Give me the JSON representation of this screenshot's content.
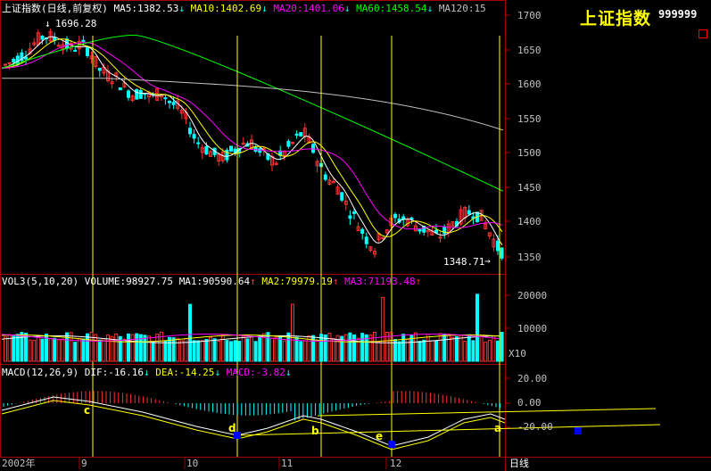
{
  "window": {
    "title": "上证指数",
    "code": "999999"
  },
  "price_panel": {
    "header": {
      "name": "上证指数(日线,前复权)",
      "ma5": "MA5:1382.53",
      "ma10": "MA10:1402.69",
      "ma20": "MA20:1401.06",
      "ma60": "MA60:1458.54",
      "ma120": "MA120:15",
      "arrow": "↓"
    },
    "y_ticks": [
      "1700",
      "1650",
      "1600",
      "1550",
      "1500",
      "1450",
      "1400",
      "1350"
    ],
    "high_label": "1696.28",
    "low_label": "1348.71"
  },
  "volume_panel": {
    "header": {
      "name": "VOL3(5,10,20)",
      "volume": "VOLUME:98927.75",
      "ma1": "MA1:90590.64",
      "ma2": "MA2:79979.19",
      "ma3": "MA3:71193.48",
      "arrow": "↑"
    },
    "y_ticks": [
      "20000",
      "10000"
    ],
    "unit": "X10"
  },
  "macd_panel": {
    "header": {
      "name": "MACD(12,26,9)",
      "dif": "DIF:-16.16",
      "dea": "DEA:-14.25",
      "macd": "MACD:-3.82",
      "arrow": "↓"
    },
    "y_ticks": [
      "20.00",
      "0.00",
      "-20.00"
    ],
    "point_labels": [
      "c",
      "d",
      "b",
      "e",
      "a"
    ]
  },
  "x_axis": {
    "labels": [
      "2002年",
      "9",
      "10",
      "11",
      "12"
    ],
    "period": "日线"
  },
  "colors": {
    "up": "#ff3232",
    "down": "#00ffff",
    "ma5": "#ffffff",
    "ma10": "#ffff00",
    "ma20": "#ff00ff",
    "ma60": "#00ff00",
    "ma120": "#c0c0c0",
    "grid": "#a00000"
  },
  "chart_data": {
    "type": "candlestick",
    "title": "上证指数(日线,前复权)",
    "y_range": [
      1340,
      1720
    ],
    "series": [
      {
        "name": "MA5",
        "last": 1382.53
      },
      {
        "name": "MA10",
        "last": 1402.69
      },
      {
        "name": "MA20",
        "last": 1401.06
      },
      {
        "name": "MA60",
        "last": 1458.54
      }
    ],
    "annotations": {
      "max": 1696.28,
      "min": 1348.71
    },
    "volume": {
      "last": 98927.75,
      "ma1": 90590.64,
      "ma2": 79979.19,
      "ma3": 71193.48
    },
    "macd": {
      "dif": -16.16,
      "dea": -14.25,
      "macd": -3.82
    }
  }
}
